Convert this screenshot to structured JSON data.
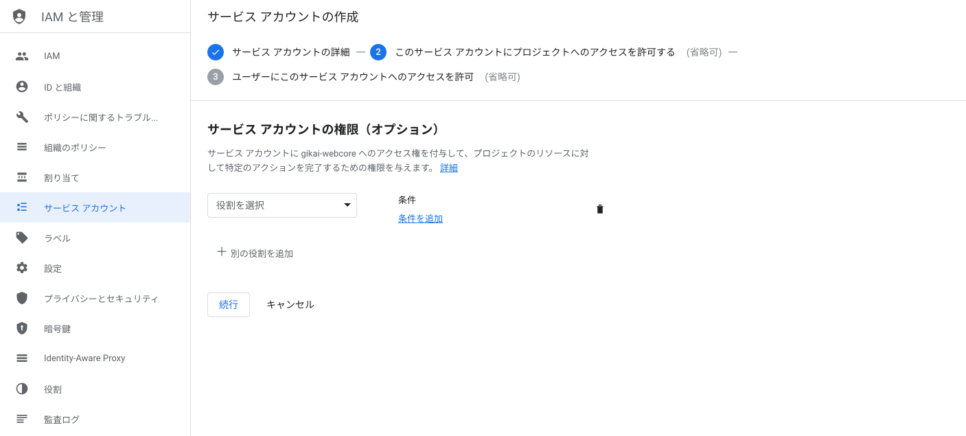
{
  "sidebar": {
    "title": "IAM と管理",
    "items": [
      {
        "label": "IAM",
        "icon": "people"
      },
      {
        "label": "ID と組織",
        "icon": "account"
      },
      {
        "label": "ポリシーに関するトラブル...",
        "icon": "wrench"
      },
      {
        "label": "組織のポリシー",
        "icon": "list"
      },
      {
        "label": "割り当て",
        "icon": "quota"
      },
      {
        "label": "サービス アカウント",
        "icon": "service",
        "active": true
      },
      {
        "label": "ラベル",
        "icon": "tag"
      },
      {
        "label": "設定",
        "icon": "gear"
      },
      {
        "label": "プライバシーとセキュリティ",
        "icon": "shield"
      },
      {
        "label": "暗号鍵",
        "icon": "key"
      },
      {
        "label": "Identity-Aware Proxy",
        "icon": "iap"
      },
      {
        "label": "役割",
        "icon": "roles"
      },
      {
        "label": "監査ログ",
        "icon": "logs"
      }
    ]
  },
  "page": {
    "title": "サービス アカウントの作成"
  },
  "stepper": {
    "step1": {
      "label": "サービス アカウントの詳細"
    },
    "step2": {
      "num": "2",
      "label": "このサービス アカウントにプロジェクトへのアクセスを許可する",
      "optional": "(省略可)"
    },
    "step3": {
      "num": "3",
      "label": "ユーザーにこのサービス アカウントへのアクセスを許可",
      "optional": "(省略可)"
    }
  },
  "section": {
    "title": "サービス アカウントの権限（オプション）",
    "desc_prefix": "サービス アカウントに gikai-webcore へのアクセス権を付与して、プロジェクトのリソースに対して特定のアクションを完了するための権限を与えます。",
    "desc_link": "詳細"
  },
  "role": {
    "select_placeholder": "役割を選択",
    "condition_label": "条件",
    "add_condition": "条件を追加",
    "add_another": "別の役割を追加"
  },
  "buttons": {
    "continue": "続行",
    "cancel": "キャンセル"
  }
}
